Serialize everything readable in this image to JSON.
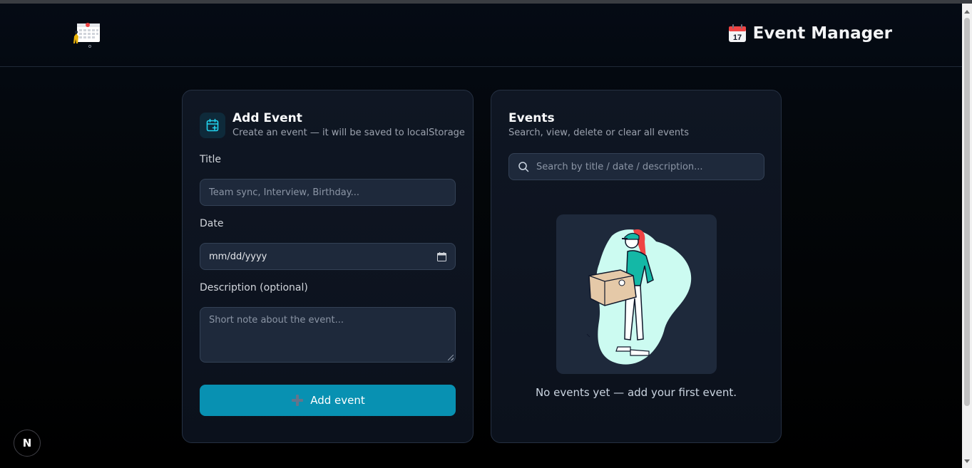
{
  "header": {
    "brand_emoji": "📅",
    "brand_title": "Event Manager",
    "logo_icon": "calendar-person-icon"
  },
  "add_card": {
    "title": "Add Event",
    "subtitle": "Create an event — it will be saved to localStorage",
    "icon": "calendar-plus-icon",
    "title_label": "Title",
    "title_placeholder": "Team sync, Interview, Birthday...",
    "date_label": "Date",
    "date_value": "mm/dd/yyyy",
    "description_label": "Description (optional)",
    "description_placeholder": "Short note about the event...",
    "add_button_label": "Add event",
    "add_button_icon": "plus-icon"
  },
  "events_card": {
    "title": "Events",
    "subtitle": "Search, view, delete or clear all events",
    "search_placeholder": "Search by title / date / description...",
    "empty_message": "No events yet — add your first event.",
    "illustration": "delivery-person-holding-box"
  },
  "next_badge": "N",
  "colors": {
    "accent": "#0891b2",
    "card_bg": "#0f1623",
    "input_bg": "#1e293b",
    "illustration_teal": "#14b8a6"
  }
}
